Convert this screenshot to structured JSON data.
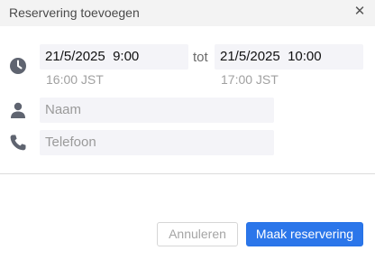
{
  "dialog": {
    "title": "Reservering toevoegen",
    "close_glyph": "✕"
  },
  "time": {
    "icon": "clock-icon",
    "start": "21/5/2025  9:00",
    "separator": "tot",
    "end": "21/5/2025  10:00",
    "start_tz": "16:00 JST",
    "end_tz": "17:00 JST"
  },
  "name": {
    "icon": "person-icon",
    "placeholder": "Naam"
  },
  "phone": {
    "icon": "phone-icon",
    "placeholder": "Telefoon"
  },
  "buttons": {
    "cancel_label": "Annuleren",
    "submit_label": "Maak reservering"
  },
  "colors": {
    "primary": "#2b76ea",
    "icon": "#5f6470"
  }
}
